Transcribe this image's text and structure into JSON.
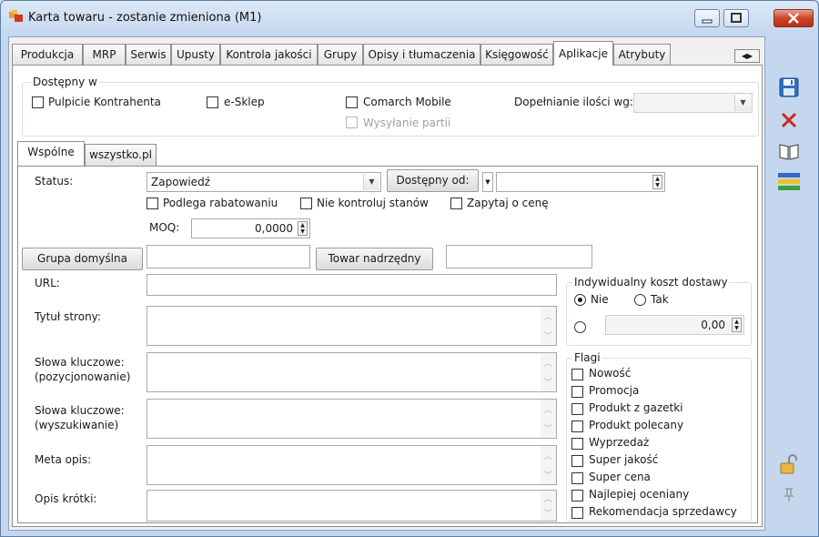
{
  "window": {
    "title": "Karta towaru - zostanie zmieniona (M1)"
  },
  "tabs": [
    "Produkcja",
    "MRP",
    "Serwis",
    "Upusty",
    "Kontrola jakości",
    "Grupy",
    "Opisy i tłumaczenia",
    "Księgowość",
    "Aplikacje",
    "Atrybuty"
  ],
  "active_tab": "Aplikacje",
  "dostepny": {
    "legend": "Dostępny w",
    "pulpit": "Pulpicie Kontrahenta",
    "esklep": "e-Sklep",
    "mobile": "Comarch Mobile",
    "wysylanie": "Wysyłanie partii",
    "dopelnianie_label": "Dopełnianie ilości wg:",
    "dopelnianie_value": ""
  },
  "subtabs": [
    "Wspólne",
    "wszystko.pl"
  ],
  "active_subtab": "Wspólne",
  "form": {
    "status_label": "Status:",
    "status_value": "Zapowiedź",
    "dostepny_od_button": "Dostępny od:",
    "dostepny_od_value": "",
    "rabat_label": "Podlega rabatowaniu",
    "nie_kontroluj_label": "Nie kontroluj stanów",
    "zapytaj_label": "Zapytaj o cenę",
    "moq_label": "MOQ:",
    "moq_value": "0,0000",
    "grupa_button": "Grupa domyślna",
    "grupa_value": "",
    "towar_button": "Towar nadrzędny",
    "towar_value": "",
    "url_label": "URL:",
    "tytul_label": "Tytuł strony:",
    "slowa_poz_label1": "Słowa kluczowe:",
    "slowa_poz_label2": "(pozycjonowanie)",
    "slowa_wysz_label1": "Słowa kluczowe:",
    "slowa_wysz_label2": "(wyszukiwanie)",
    "meta_label": "Meta opis:",
    "opis_label": "Opis krótki:"
  },
  "koszt": {
    "legend": "Indywidualny koszt dostawy",
    "nie": "Nie",
    "tak": "Tak",
    "value": "0,00"
  },
  "flagi": {
    "legend": "Flagi",
    "items": [
      "Nowość",
      "Promocja",
      "Produkt z gazetki",
      "Produkt polecany",
      "Wyprzedaż",
      "Super jakość",
      "Super cena",
      "Najlepiej oceniany",
      "Rekomendacja sprzedawcy"
    ]
  },
  "toolbar_icons": [
    "save-icon",
    "cancel-icon",
    "book-icon",
    "layers-icon",
    "unlock-icon",
    "pin-icon"
  ]
}
